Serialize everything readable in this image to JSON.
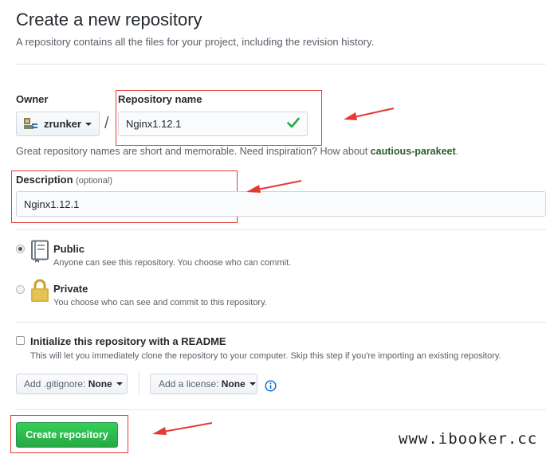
{
  "page": {
    "title": "Create a new repository",
    "subtitle": "A repository contains all the files for your project, including the revision history."
  },
  "owner": {
    "label": "Owner",
    "value": "zrunker"
  },
  "separator": "/",
  "repo_name": {
    "label": "Repository name",
    "value": "Nginx1.12.1",
    "status_icon": "checkmark-icon",
    "status_color": "#28a745"
  },
  "name_hint": {
    "prefix": "Great repository names are short and memorable. Need inspiration? How about ",
    "suggestion": "cautious-parakeet",
    "suffix": "."
  },
  "description": {
    "label": "Description",
    "optional": "(optional)",
    "value": "Nginx1.12.1"
  },
  "visibility": {
    "public": {
      "label": "Public",
      "note": "Anyone can see this repository. You choose who can commit.",
      "selected": true,
      "icon": "repo-book-icon"
    },
    "private": {
      "label": "Private",
      "note": "You choose who can see and commit to this repository.",
      "selected": false,
      "icon": "lock-icon"
    }
  },
  "readme": {
    "label": "Initialize this repository with a README",
    "note": "This will let you immediately clone the repository to your computer. Skip this step if you're importing an existing repository.",
    "checked": false
  },
  "gitignore": {
    "label": "Add .gitignore:",
    "value": "None"
  },
  "license": {
    "label": "Add a license:",
    "value": "None",
    "info_icon": "info-icon"
  },
  "create_button": "Create repository",
  "watermark": "www.ibooker.cc",
  "colors": {
    "accent_green": "#28a745",
    "annotation_red": "#e53935",
    "suggestion_green": "#2c5c2c"
  }
}
